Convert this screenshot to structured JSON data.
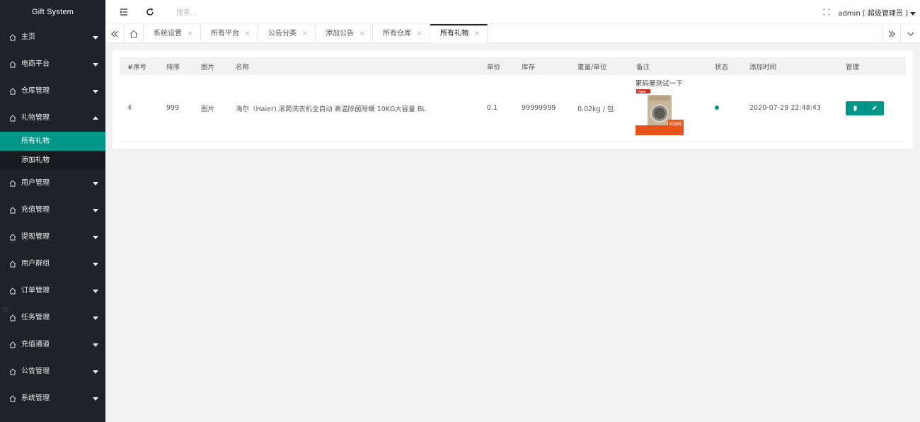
{
  "app": {
    "title": "Gift System"
  },
  "sidebar": {
    "items": [
      {
        "label": "主页"
      },
      {
        "label": "电商平台"
      },
      {
        "label": "仓库管理"
      },
      {
        "label": "礼物管理",
        "expanded": true,
        "children": [
          {
            "label": "所有礼物",
            "active": true
          },
          {
            "label": "添加礼物"
          }
        ]
      },
      {
        "label": "用户管理"
      },
      {
        "label": "充值管理"
      },
      {
        "label": "提现管理"
      },
      {
        "label": "用户群组"
      },
      {
        "label": "订单管理"
      },
      {
        "label": "任务管理"
      },
      {
        "label": "充值通道"
      },
      {
        "label": "公告管理"
      },
      {
        "label": "系统管理"
      }
    ]
  },
  "header": {
    "search_placeholder": "搜索...",
    "user_label": "admin [ 超级管理员 ]",
    "icons": [
      "menu-fold-icon",
      "refresh-icon",
      "fullscreen-icon"
    ]
  },
  "tabs": {
    "items": [
      {
        "label": "系统设置"
      },
      {
        "label": "所有平台"
      },
      {
        "label": "公告分类"
      },
      {
        "label": "添加公告"
      },
      {
        "label": "所有仓库"
      },
      {
        "label": "所有礼物",
        "active": true
      }
    ],
    "close_glyph": "×"
  },
  "table": {
    "headers": [
      "#序号",
      "排序",
      "图片",
      "名称",
      "单价",
      "库存",
      "重量/单位",
      "备注",
      "状态",
      "添加时间",
      "管理"
    ],
    "rows": [
      {
        "id": "4",
        "sort": "999",
        "image": "图片",
        "name": "海尔（Haier) 滚筒洗衣机全自动 高温除菌除螨 10KG大容量 BL",
        "price": "0.1",
        "stock": "99999999",
        "weight": "0.02kg / 包",
        "remark_text": "累码屋测试一下",
        "product_brand": "Haier",
        "product_price_tag": "¥1899",
        "status": "enabled",
        "added": "2020-07-29 22:48:43"
      }
    ]
  },
  "colors": {
    "accent": "#009688",
    "sidebar_bg": "#20222a"
  }
}
